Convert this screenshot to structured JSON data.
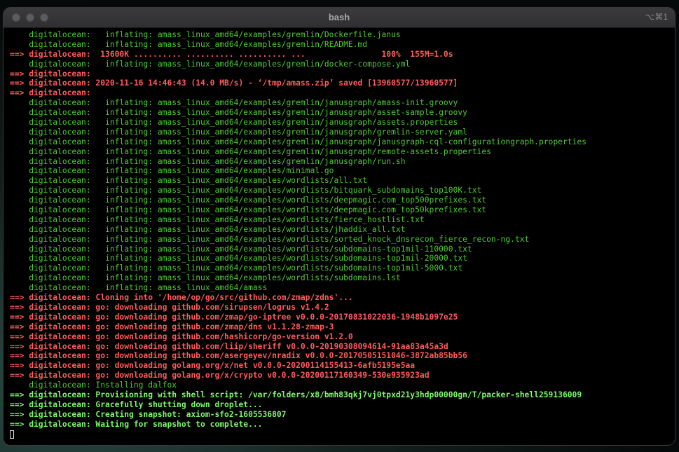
{
  "window": {
    "title": "bash",
    "shortcut": "⌥⌘1"
  },
  "colors": {
    "green": "#4fc934",
    "red": "#ff5c5c",
    "bright_green": "#7dfa6a",
    "background": "#000000"
  },
  "lines": [
    {
      "style": "green",
      "text": "    digitalocean:   inflating: amass_linux_amd64/examples/gremlin/Dockerfile.janus"
    },
    {
      "style": "green",
      "text": "    digitalocean:   inflating: amass_linux_amd64/examples/gremlin/README.md"
    },
    {
      "style": "red",
      "text": "==> digitalocean:  13600K .......... .......... .......... ...                100%  155M=1.0s"
    },
    {
      "style": "green",
      "text": "    digitalocean:   inflating: amass_linux_amd64/examples/gremlin/docker-compose.yml"
    },
    {
      "style": "red",
      "text": "==> digitalocean:"
    },
    {
      "style": "red",
      "text": "==> digitalocean: 2020-11-16 14:46:43 (14.0 MB/s) - ‘/tmp/amass.zip’ saved [13960577/13960577]"
    },
    {
      "style": "red",
      "text": "==> digitalocean:"
    },
    {
      "style": "green",
      "text": "    digitalocean:   inflating: amass_linux_amd64/examples/gremlin/janusgraph/amass-init.groovy"
    },
    {
      "style": "green",
      "text": "    digitalocean:   inflating: amass_linux_amd64/examples/gremlin/janusgraph/asset-sample.groovy"
    },
    {
      "style": "green",
      "text": "    digitalocean:   inflating: amass_linux_amd64/examples/gremlin/janusgraph/assets.properties"
    },
    {
      "style": "green",
      "text": "    digitalocean:   inflating: amass_linux_amd64/examples/gremlin/janusgraph/gremlin-server.yaml"
    },
    {
      "style": "green",
      "text": "    digitalocean:   inflating: amass_linux_amd64/examples/gremlin/janusgraph/janusgraph-cql-configurationgraph.properties"
    },
    {
      "style": "green",
      "text": "    digitalocean:   inflating: amass_linux_amd64/examples/gremlin/janusgraph/remote-assets.properties"
    },
    {
      "style": "green",
      "text": "    digitalocean:   inflating: amass_linux_amd64/examples/gremlin/janusgraph/run.sh"
    },
    {
      "style": "green",
      "text": "    digitalocean:   inflating: amass_linux_amd64/examples/minimal.go"
    },
    {
      "style": "green",
      "text": "    digitalocean:   inflating: amass_linux_amd64/examples/wordlists/all.txt"
    },
    {
      "style": "green",
      "text": "    digitalocean:   inflating: amass_linux_amd64/examples/wordlists/bitquark_subdomains_top100K.txt"
    },
    {
      "style": "green",
      "text": "    digitalocean:   inflating: amass_linux_amd64/examples/wordlists/deepmagic.com_top500prefixes.txt"
    },
    {
      "style": "green",
      "text": "    digitalocean:   inflating: amass_linux_amd64/examples/wordlists/deepmagic.com_top50kprefixes.txt"
    },
    {
      "style": "green",
      "text": "    digitalocean:   inflating: amass_linux_amd64/examples/wordlists/fierce_hostlist.txt"
    },
    {
      "style": "green",
      "text": "    digitalocean:   inflating: amass_linux_amd64/examples/wordlists/jhaddix_all.txt"
    },
    {
      "style": "green",
      "text": "    digitalocean:   inflating: amass_linux_amd64/examples/wordlists/sorted_knock_dnsrecon_fierce_recon-ng.txt"
    },
    {
      "style": "green",
      "text": "    digitalocean:   inflating: amass_linux_amd64/examples/wordlists/subdomains-top1mil-110000.txt"
    },
    {
      "style": "green",
      "text": "    digitalocean:   inflating: amass_linux_amd64/examples/wordlists/subdomains-top1mil-20000.txt"
    },
    {
      "style": "green",
      "text": "    digitalocean:   inflating: amass_linux_amd64/examples/wordlists/subdomains-top1mil-5000.txt"
    },
    {
      "style": "green",
      "text": "    digitalocean:   inflating: amass_linux_amd64/examples/wordlists/subdomains.lst"
    },
    {
      "style": "green",
      "text": "    digitalocean:   inflating: amass_linux_amd64/amass"
    },
    {
      "style": "red",
      "text": "==> digitalocean: Cloning into '/home/op/go/src/github.com/zmap/zdns'..."
    },
    {
      "style": "red",
      "text": "==> digitalocean: go: downloading github.com/sirupsen/logrus v1.4.2"
    },
    {
      "style": "red",
      "text": "==> digitalocean: go: downloading github.com/zmap/go-iptree v0.0.0-20170831022036-1948b1097e25"
    },
    {
      "style": "red",
      "text": "==> digitalocean: go: downloading github.com/zmap/dns v1.1.28-zmap-3"
    },
    {
      "style": "red",
      "text": "==> digitalocean: go: downloading github.com/hashicorp/go-version v1.2.0"
    },
    {
      "style": "red",
      "text": "==> digitalocean: go: downloading github.com/liip/sheriff v0.0.0-20190308094614-91aa83a45a3d"
    },
    {
      "style": "red",
      "text": "==> digitalocean: go: downloading github.com/asergeyev/nradix v0.0.0-20170505151046-3872ab85bb56"
    },
    {
      "style": "red",
      "text": "==> digitalocean: go: downloading golang.org/x/net v0.0.0-20200114155413-6afb5195e5aa"
    },
    {
      "style": "red",
      "text": "==> digitalocean: go: downloading golang.org/x/crypto v0.0.0-20200117160349-530e935923ad"
    },
    {
      "style": "green",
      "text": "    digitalocean: Installing dalfox"
    },
    {
      "style": "bright",
      "text": "==> digitalocean: Provisioning with shell script: /var/folders/x8/bmh83qkj7vj0tpxd21y3hdp00000gn/T/packer-shell259136009"
    },
    {
      "style": "bright",
      "text": "==> digitalocean: Gracefully shutting down droplet..."
    },
    {
      "style": "bright",
      "text": "==> digitalocean: Creating snapshot: axiom-sfo2-1605536807"
    },
    {
      "style": "bright",
      "text": "==> digitalocean: Waiting for snapshot to complete..."
    }
  ]
}
